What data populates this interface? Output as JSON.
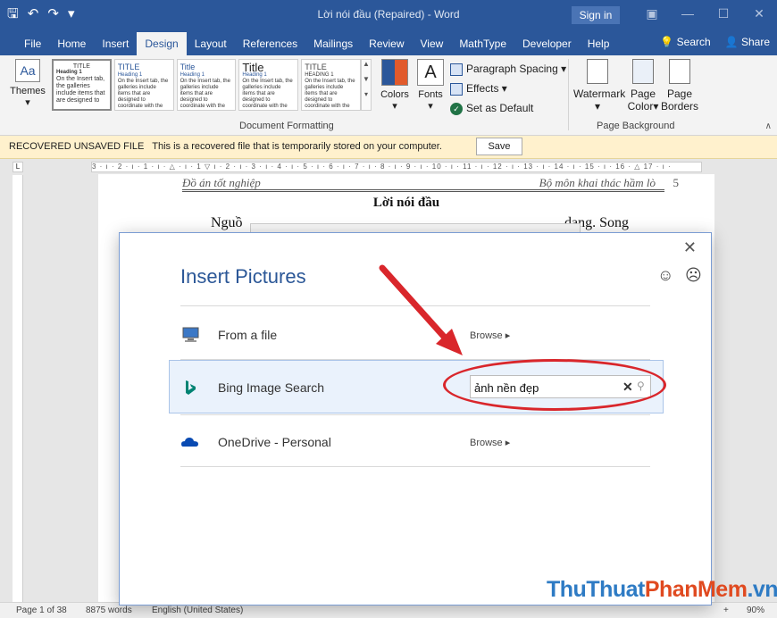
{
  "window": {
    "title": "Lời nói đầu (Repaired)  -  Word",
    "sign_in": "Sign in"
  },
  "tabs": [
    "File",
    "Home",
    "Insert",
    "Design",
    "Layout",
    "References",
    "Mailings",
    "Review",
    "View",
    "MathType",
    "Developer",
    "Help"
  ],
  "active_tab": "Design",
  "tab_right": {
    "search": "Search",
    "share": "Share"
  },
  "ribbon": {
    "themes_label": "Themes",
    "gallery": [
      {
        "title": "TITLE",
        "heading": "Heading 1",
        "body": "On the Insert tab, the galleries include items that are designed to"
      },
      {
        "title": "TITLE",
        "heading": "Heading 1",
        "body": "On the Insert tab, the galleries include items that are designed to coordinate with the overall look of your document."
      },
      {
        "title": "Title",
        "heading": "Heading 1",
        "body": "On the Insert tab, the galleries include items that are designed to coordinate with the overall look of your document."
      },
      {
        "title": "Title",
        "heading": "Heading 1",
        "body": "On the Insert tab, the galleries include items that are designed to coordinate with the overall look."
      },
      {
        "title": "TITLE",
        "heading": "HEADING 1",
        "body": "On the Insert tab, the galleries include items that are designed to coordinate with the overall look."
      }
    ],
    "colors_label": "Colors",
    "fonts_label": "Fonts",
    "paragraph_spacing": "Paragraph Spacing",
    "effects": "Effects",
    "set_as_default": "Set as Default",
    "document_formatting_group": "Document Formatting",
    "watermark": "Watermark",
    "page_color": "Page Color",
    "page_color_1": "Page",
    "page_color_2": "Color",
    "page_borders_1": "Page",
    "page_borders_2": "Borders",
    "page_background_group": "Page Background"
  },
  "message_bar": {
    "title": "RECOVERED UNSAVED FILE",
    "text": "This is a recovered file that is temporarily stored on your computer.",
    "save": "Save"
  },
  "ruler_text": "3 · ı · 2 · ı · 1 · ı · △ · ı · 1 ▽ ı · 2 · ı · 3 · ı · 4 · ı · 5 · ı · 6 · ı · 7 · ı · 8 · ı · 9 · ı · 10 · ı · 11 · ı · 12 · ı · 13 · ı · 14 · ı · 15 · ı · 16 · △ 17 · ı ·",
  "document": {
    "header_left": "Đồ án tốt nghiệp",
    "header_right": "Bộ môn khai thác hầm lò",
    "page_number": "5",
    "title": "Lời nói đầu",
    "line_start": "Nguồ",
    "line_end": "dạng. Song"
  },
  "dialog": {
    "title": "Insert Pictures",
    "rows": [
      {
        "label": "From a file",
        "action": "Browse"
      },
      {
        "label": "Bing Image Search",
        "search_value": "ảnh nền đẹp"
      },
      {
        "label": "OneDrive - Personal",
        "action": "Browse"
      }
    ]
  },
  "status": {
    "page": "Page 1 of 38",
    "words": "8875 words",
    "language": "English (United States)",
    "zoom": "90%"
  },
  "watermark": {
    "part1": "ThuThuat",
    "part2": "PhanMem",
    "part3": ".vn"
  },
  "colors": {
    "word_blue": "#2b579a",
    "dialog_title": "#2b5797",
    "annotation_red": "#d9262b",
    "bing": "#008373",
    "onedrive": "#094ab2"
  }
}
